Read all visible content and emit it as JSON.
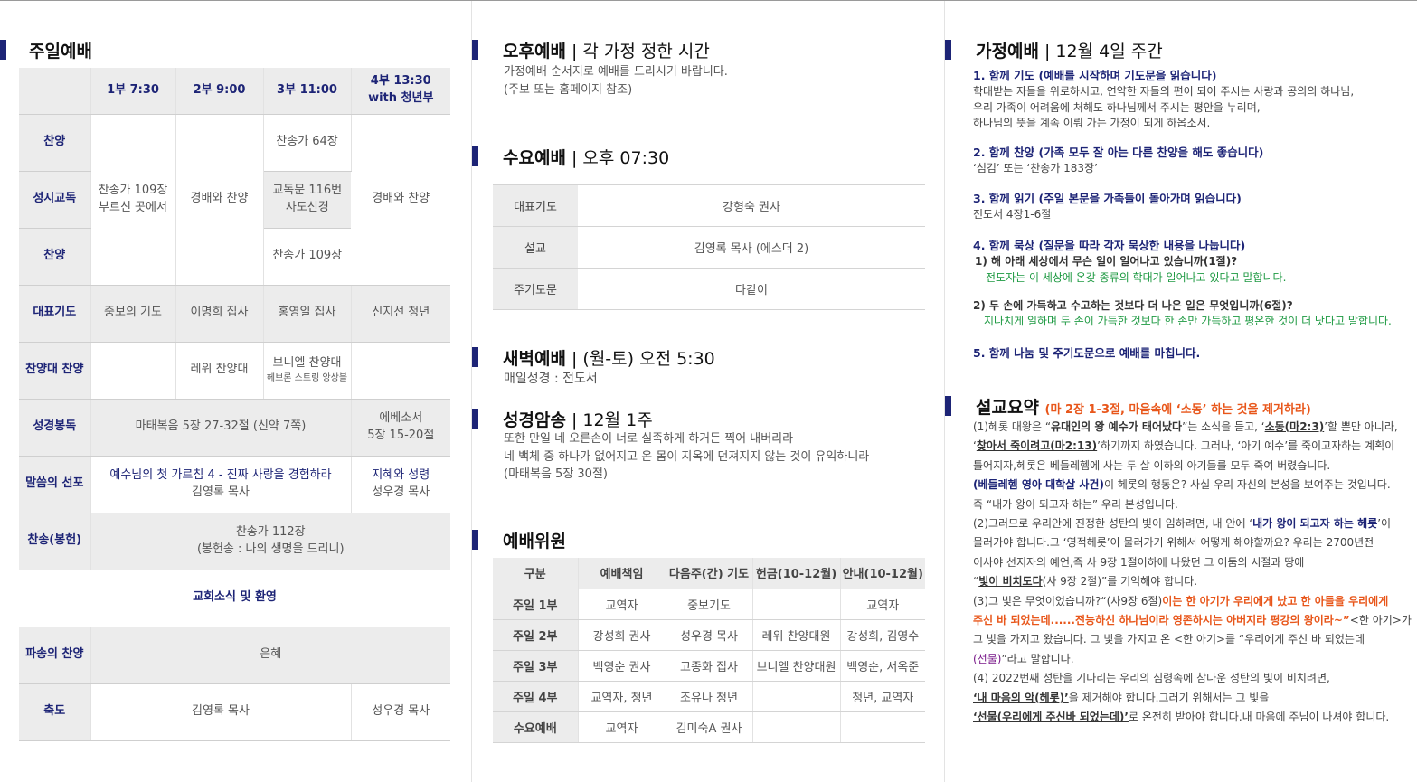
{
  "sunday": {
    "title": "주일예배",
    "header": [
      "",
      "1부 7:30",
      "2부 9:00",
      "3부 11:00",
      "4부 13:30",
      "with 청년부"
    ],
    "labels": [
      "찬양",
      "성시교독",
      "찬양",
      "대표기도",
      "찬양대 찬양",
      "성경봉독",
      "말씀의 선포",
      "찬송(봉헌)",
      "파송의 찬양",
      "축도"
    ],
    "hymn_109_line1": "찬송가 109장",
    "hymn_109_line2": "부르신 곳에서",
    "worship_praise": "경배와 찬양",
    "hymn_64": "찬송가 64장",
    "creed_line1": "교독문 116번",
    "creed_line2": "사도신경",
    "hymn_109b": "찬송가 109장",
    "worship_praise_4": "경배와 찬양",
    "prayers": [
      "중보의 기도",
      "이명희 집사",
      "홍영일 집사",
      "신지선 청년"
    ],
    "choir_2": "레위 찬양대",
    "choir_3_line1": "브니엘 찬양대",
    "choir_3_line2": "헤브론 스트링 앙상블",
    "reading_main": "마태복음 5장 27-32절 (신약 7쪽)",
    "reading_4_line1": "에베소서",
    "reading_4_line2": "5장 15-20절",
    "sermon_title": "예수님의 첫 가르침 4 - 진짜 사랑을 경험하라",
    "sermon_preacher": "김영록 목사",
    "sermon4_title": "지혜와 성령",
    "sermon4_preacher": "성우경 목사",
    "offering_line1": "찬송가 112장",
    "offering_line2": "(봉헌송 : 나의 생명을 드리니)",
    "news": "교회소식 및 환영",
    "sending": "은혜",
    "benediction_main": "김영록 목사",
    "benediction_4": "성우경 목사"
  },
  "afternoon": {
    "title": "오후예배",
    "subtitle": "각 가정 정한 시간",
    "line1": "가정예배 순서지로 예배를 드리시기 바랍니다.",
    "line2": "(주보 또는 홈페이지 참조)"
  },
  "wednesday": {
    "title": "수요예배",
    "subtitle": "오후 07:30",
    "rows": [
      {
        "label": "대표기도",
        "value": "강형숙 권사"
      },
      {
        "label": "설교",
        "value": "김영록 목사 (에스더 2)"
      },
      {
        "label": "주기도문",
        "value": "다같이"
      }
    ]
  },
  "dawn": {
    "title": "새벽예배",
    "subtitle": "(월-토) 오전 5:30",
    "line": "매일성경 : 전도서"
  },
  "memory": {
    "title": "성경암송",
    "subtitle": "12월 1주",
    "lines": [
      "또한 만일 네 오른손이 너로 실족하게 하거든 찍어 내버리라",
      "네 백체 중 하나가 없어지고 온 몸이 지옥에 던져지지 않는 것이 유익하니라",
      "(마태복음 5장 30절)"
    ]
  },
  "staff": {
    "title": "예배위원",
    "header": [
      "구분",
      "예배책임",
      "다음주(간) 기도",
      "헌금(10-12월)",
      "안내(10-12월)"
    ],
    "rows": [
      [
        "주일 1부",
        "교역자",
        "중보기도",
        "",
        "교역자"
      ],
      [
        "주일 2부",
        "강성희 권사",
        "성우경 목사",
        "레위 찬양대원",
        "강성희, 김영수"
      ],
      [
        "주일 3부",
        "백영순 권사",
        "고종화 집사",
        "브니엘 찬양대원",
        "백영순, 서옥준"
      ],
      [
        "주일 4부",
        "교역자, 청년",
        "조유나 청년",
        "",
        "청년, 교역자"
      ],
      [
        "수요예배",
        "교역자",
        "김미숙A 권사",
        "",
        ""
      ]
    ]
  },
  "family": {
    "title": "가정예배",
    "subtitle": "12월 4일 주간",
    "s1_title": "1. 함께 기도 (예배를 시작하며 기도문을 읽습니다)",
    "s1_lines": [
      "학대받는 자들을 위로하시고, 연약한 자들의 편이 되어 주시는 사랑과 공의의 하나님,",
      "우리 가족이 어려움에 처해도 하나님께서 주시는 평안을 누리며,",
      "하나님의 뜻을 계속 이뤄 가는 가정이 되게 하옵소서."
    ],
    "s2_title": "2. 함께 찬양 (가족 모두 잘 아는 다른 찬양을 해도 좋습니다)",
    "s2_line": "‘섬김’ 또는 ‘찬송가 183장’",
    "s3_title": "3. 함께 읽기 (주일 본문을 가족들이 돌아가며 읽습니다)",
    "s3_line": "전도서 4장1-6절",
    "s4_title": "4. 함께 묵상 (질문을 따라 각자 묵상한 내용을 나눕니다)",
    "q1": "1) 해 아래 세상에서 무슨 일이 일어나고 있습니까(1절)?",
    "a1": "전도자는 이 세상에 온갖 종류의 학대가 일어나고 있다고 말합니다.",
    "q2": "2) 두 손에 가득하고 수고하는 것보다 더 나은 일은 무엇입니까(6절)?",
    "a2": "지나치게 일하며 두 손이 가득한 것보다 한 손만 가득하고 평온한 것이 더 낫다고 말합니다.",
    "s5_title": "5. 함께 나눔 및 주기도문으로 예배를 마칩니다."
  },
  "sermon": {
    "title": "설교요약",
    "subtitle": "(마 2장 1-3절, 마음속에 ‘소동’ 하는 것을 제거하라)",
    "p1a": "(1)헤롯 대왕은 “",
    "p1b": "유대인의 왕 예수가 태어났다",
    "p1c": "”는 소식을 듣고, ‘",
    "p1d": "소동(마2:3)",
    "p1e": "’할 뿐만 아니라,",
    "p2a": "‘",
    "p2b": "찾아서 죽이려고(마2:13)",
    "p2c": "’하기까지 하였습니다. 그러나, ‘아기 예수’를 죽이고자하는 계획이",
    "p3": "틀어지자,헤롯은 베들레헴에 사는 두 살 이하의 아기들를 모두 죽여 버렸습니다.",
    "p4a": "(베들레헴 영아 대학살 사건)",
    "p4b": "이 헤롯의 행동은? 사실 우리 자신의 본성을 보여주는 것입니다.",
    "p5": "즉 “내가 왕이 되고자 하는” 우리 본성입니다.",
    "p6a": "(2)그러므로 우리안에 진정한 성탄의 빛이 임하려면, 내 안에 ‘",
    "p6b": "내가 왕이 되고자 하는 헤롯",
    "p6c": "’이",
    "p7": "물러가야 합니다.그 ‘영적헤롯’이 물러가기 위해서 어떻게 해야할까요? 우리는 2700년전",
    "p8": "이사야 선지자의 예언,즉 사 9장 1절이하에 나왔던 그 어둠의 시절과 땅에",
    "p9a": "“",
    "p9b": "빛이 비치도다",
    "p9c": "(사 9장 2절)”를 기억해야 합니다.",
    "p10a": "(3)그 빛은 무엇이었습니까?“(사9장 6절)",
    "p10b": "이는 한 아기가 우리에게 났고 한 아들을 우리에게",
    "p11a": "주신 바 되었는데......전능하신 하나님이라 영존하시는 아버지라 평강의 왕이라~”",
    "p11b": "<한 아기>가",
    "p12": "그 빛을 가지고 왔습니다. 그 빛을 가지고 온 <한 아기>를 “우리에게 주신 바 되었는데",
    "p13a": "(선물)",
    "p13b": "”라고 말합니다.",
    "p14": "(4) 2022번째 성탄을 기다리는 우리의 심령속에 참다운 성탄의 빛이 비치려면,",
    "p15a": "‘내 마음의 악(헤롯)’",
    "p15b": "을 제거해야 합니다.그러기 위해서는 그 빛을",
    "p16a": "‘선물(우리에게 주신바 되었는데)’",
    "p16b": "로 온전히 받아야 합니다.내 마음에 주님이 나셔야 합니다."
  }
}
